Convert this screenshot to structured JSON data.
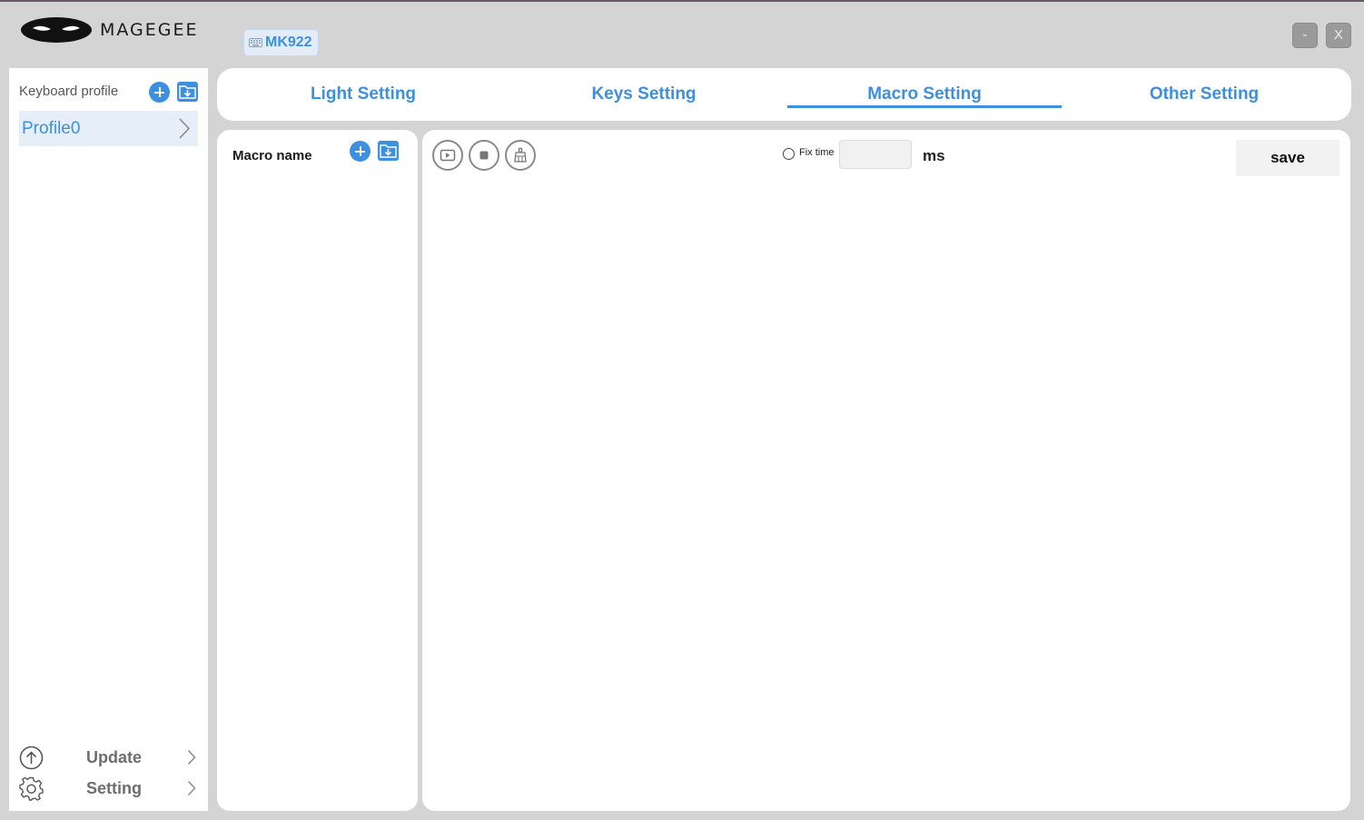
{
  "app": {
    "brand": "MAGEGEE",
    "device": "MK922",
    "window_controls": {
      "minimize": "-",
      "close": "X"
    }
  },
  "sidebar": {
    "profile_header": "Keyboard profile",
    "profiles": [
      {
        "label": "Profile0"
      }
    ],
    "bottom": [
      {
        "label": "Update",
        "icon": "upload-circle-icon"
      },
      {
        "label": "Setting",
        "icon": "gear-icon"
      }
    ]
  },
  "tabs": [
    {
      "label": "Light Setting",
      "active": false
    },
    {
      "label": "Keys Setting",
      "active": false
    },
    {
      "label": "Macro Setting",
      "active": true
    },
    {
      "label": "Other Setting",
      "active": false
    }
  ],
  "macro": {
    "list_title": "Macro name",
    "toolbar": {
      "record_icon": "record-icon",
      "stop_icon": "stop-icon",
      "clear_icon": "broom-icon"
    },
    "fix_time_label": "Fix time",
    "fix_time_value": "",
    "unit": "ms",
    "save_label": "save"
  },
  "colors": {
    "accent": "#3d8fe0",
    "background": "#d4d4d4",
    "panel": "#ffffff",
    "profile_selected": "#e6eef9"
  }
}
